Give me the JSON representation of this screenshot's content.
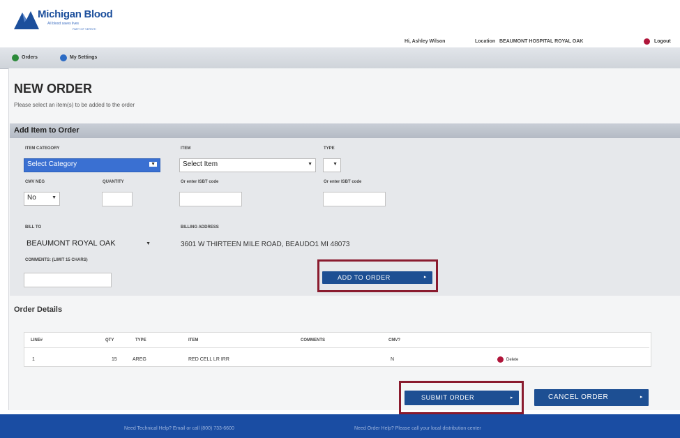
{
  "brand": {
    "name": "Michigan Blood",
    "tagline": "All blood saves lives",
    "tagline2": "PART OF VERSITI"
  },
  "userbar": {
    "user": "Hi, Ashley Wilson",
    "location_label": "Location",
    "location": "BEAUMONT HOSPITAL ROYAL OAK",
    "logout": "Logout"
  },
  "nav": {
    "orders": "Orders",
    "settings": "My Settings"
  },
  "page": {
    "title": "NEW ORDER",
    "subtitle": "Please select an item(s) to be added to the order"
  },
  "add_item": {
    "section_title": "Add Item to Order",
    "item_category_label": "ITEM CATEGORY",
    "item_category_value": "Select Category",
    "item_label": "ITEM",
    "item_value": "Select Item",
    "type_label": "TYPE",
    "cmv_label": "CMV NEG",
    "cmv_value": "No",
    "qty_label": "QUANTITY",
    "code1_label": "Or enter ISBT code",
    "code2_label": "Or enter ISBT code",
    "bill_to_label": "BILL TO",
    "bill_to_value": "BEAUMONT ROYAL OAK",
    "billing_address_label": "BILLING ADDRESS",
    "billing_address_value": "3601 W THIRTEEN MILE ROAD, BEAUDO1 MI 48073",
    "comments_label": "COMMENTS: (LIMIT 15 CHARS)",
    "add_button": "ADD TO ORDER"
  },
  "order_details": {
    "title": "Order Details",
    "columns": [
      "LINE#",
      "QTY",
      "TYPE",
      "ITEM",
      "COMMENTS",
      "CMV?"
    ],
    "rows": [
      {
        "line": "1",
        "qty": "15",
        "type": "AREG",
        "item": "RED CELL LR IRR",
        "comments": "",
        "cmv": "N",
        "action": "Delete"
      }
    ]
  },
  "actions": {
    "submit": "SUBMIT ORDER",
    "cancel": "CANCEL ORDER"
  },
  "footer": {
    "left": "Need Technical Help? Email or call (800) 733-6600",
    "right": "Need Order Help? Please call your local distribution center"
  },
  "colors": {
    "brand_blue": "#1d4f93",
    "accent_red": "#b0153a",
    "highlight_box": "#8a1b2e",
    "footer": "#1a4da3"
  }
}
